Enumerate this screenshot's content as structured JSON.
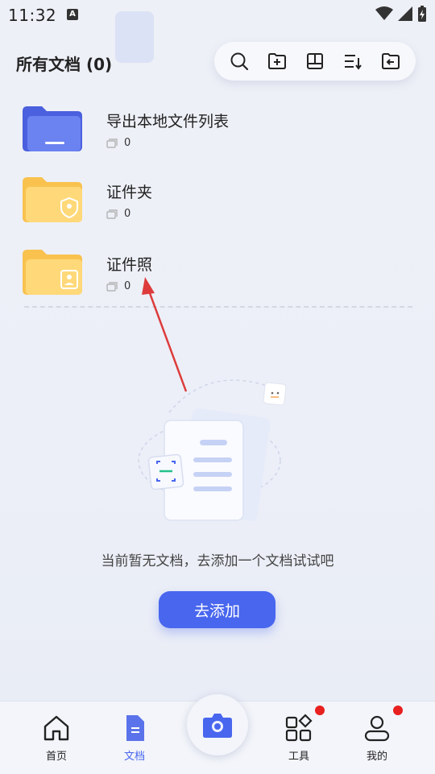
{
  "status": {
    "time": "11:32",
    "notif_letter": "A"
  },
  "header": {
    "title": "所有文档 (0)"
  },
  "toolbar": {
    "icons": [
      "search-icon",
      "new-folder-icon",
      "layout-icon",
      "sort-icon",
      "import-icon"
    ]
  },
  "folders": [
    {
      "name": "导出本地文件列表",
      "count": "0",
      "color": "#5b73ea",
      "icon": "export-folder-icon"
    },
    {
      "name": "证件夹",
      "count": "0",
      "color": "#ffd36b",
      "icon": "id-shield-folder-icon"
    },
    {
      "name": "证件照",
      "count": "0",
      "color": "#ffd36b",
      "icon": "id-photo-folder-icon"
    }
  ],
  "empty": {
    "message": "当前暂无文档，去添加一个文档试试吧",
    "button_label": "去添加"
  },
  "nav": {
    "home": "首页",
    "docs": "文档",
    "tools": "工具",
    "mine": "我的"
  },
  "colors": {
    "accent": "#4866ee",
    "badge": "#e8201f",
    "annotation_arrow": "#dd3b3b"
  }
}
